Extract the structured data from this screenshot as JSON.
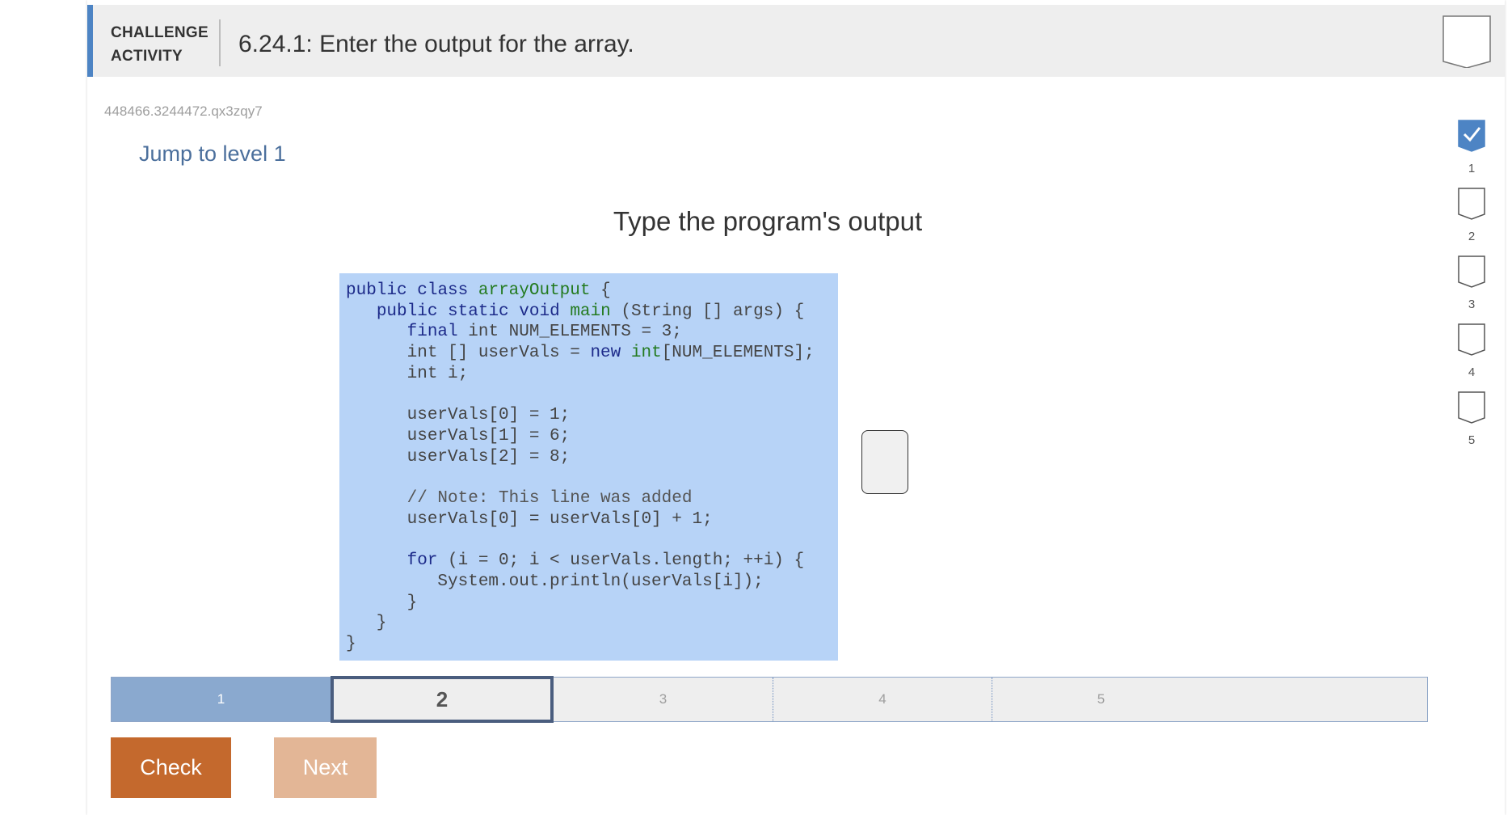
{
  "header": {
    "type_line1": "CHALLENGE",
    "type_line2": "ACTIVITY",
    "title": "6.24.1: Enter the output for the array."
  },
  "activity_id": "448466.3244472.qx3zqy7",
  "jump_link": "Jump to level 1",
  "prompt": "Type the program's output",
  "code": {
    "lines": [
      "public class arrayOutput {",
      "   public static void main (String [] args) {",
      "      final int NUM_ELEMENTS = 3;",
      "      int [] userVals = new int[NUM_ELEMENTS];",
      "      int i;",
      "",
      "      userVals[0] = 1;",
      "      userVals[1] = 6;",
      "      userVals[2] = 8;",
      "",
      "      // Note: This line was added",
      "      userVals[0] = userVals[0] + 1;",
      "",
      "      for (i = 0; i < userVals.length; ++i) {",
      "         System.out.println(userVals[i]);",
      "      }",
      "   }",
      "}"
    ]
  },
  "answer": {
    "value": ""
  },
  "progress_levels": [
    {
      "label": "1",
      "state": "done"
    },
    {
      "label": "2",
      "state": "current"
    },
    {
      "label": "3",
      "state": "pending"
    },
    {
      "label": "4",
      "state": "pending"
    },
    {
      "label": "5",
      "state": "pending"
    }
  ],
  "side_levels": [
    {
      "label": "1",
      "completed": true
    },
    {
      "label": "2",
      "completed": false
    },
    {
      "label": "3",
      "completed": false
    },
    {
      "label": "4",
      "completed": false
    },
    {
      "label": "5",
      "completed": false
    }
  ],
  "buttons": {
    "check": "Check",
    "next": "Next"
  },
  "colors": {
    "accent": "#4d84c4",
    "code_background": "#b7d3f7",
    "check_button": "#c4692d",
    "next_button": "#e3b696",
    "level_done": "#8aa9cf"
  },
  "icons": {
    "completed_level": "checkmark-badge-icon",
    "pending_level": "empty-badge-icon"
  }
}
